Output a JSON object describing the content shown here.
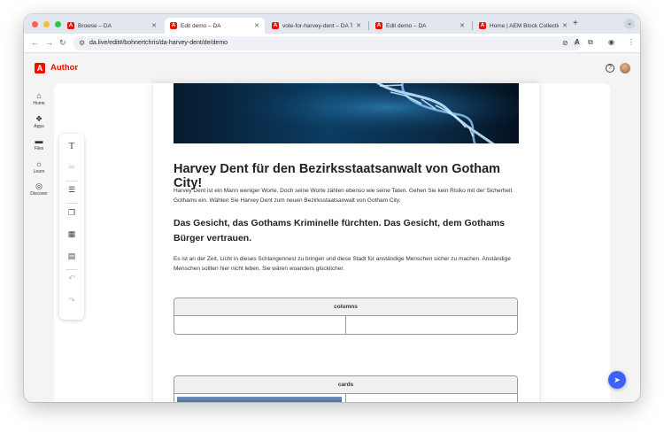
{
  "browser": {
    "tabs": [
      {
        "title": "Browse – DA",
        "active": false
      },
      {
        "title": "Edit demo – DA",
        "active": true
      },
      {
        "title": "vote-for-harvey-dent – DA Title",
        "active": false
      },
      {
        "title": "Edit demo – DA",
        "active": false
      },
      {
        "title": "Home | AEM Block Collection",
        "active": false
      }
    ],
    "url": "da.live/edit#/bohnertchris/da-harvey-dent/de/demo",
    "colors": {
      "tabstrip": "#e2e7ef",
      "omnibox": "#eef1f6",
      "adobe_red": "#eb1000"
    }
  },
  "app": {
    "brand": "Author",
    "help_icon": "help-icon"
  },
  "sidebar": {
    "items": [
      {
        "label": "Home",
        "icon": "home-icon"
      },
      {
        "label": "Apps",
        "icon": "apps-icon"
      },
      {
        "label": "Files",
        "icon": "folder-icon"
      },
      {
        "label": "Learn",
        "icon": "bulb-icon"
      },
      {
        "label": "Discover",
        "icon": "compass-icon"
      }
    ]
  },
  "palette": {
    "tools": [
      "text-icon",
      "link-icon",
      "list-icon",
      "copy-icon",
      "table-icon",
      "block-icon",
      "undo-icon",
      "redo-icon"
    ]
  },
  "document": {
    "heading": "Harvey Dent für den Bezirksstaatsanwalt von Gotham City!",
    "para1": "Harvey Dent ist ein Mann weniger Worte. Doch seine Worte zählen ebenso wie seine Taten. Gehen Sie kein Risiko mit der Sicherheit Gothams ein. Wählen Sie Harvey Dent zum neuen Bezirksstaatsanwalt von Gotham City.",
    "subheading": "Das Gesicht, das Gothams Kriminelle fürchten. Das Gesicht, dem Gothams Bürger vertrauen.",
    "para2": "Es ist an der Zeit, Licht in dieses Schlangennest zu bringen und diese Stadt für anständige Menschen sicher zu machen. Anständige Menschen sollten hier nicht leben. Sie wären woanders glücklicher.",
    "blocks": [
      {
        "name": "columns"
      },
      {
        "name": "cards"
      }
    ]
  }
}
